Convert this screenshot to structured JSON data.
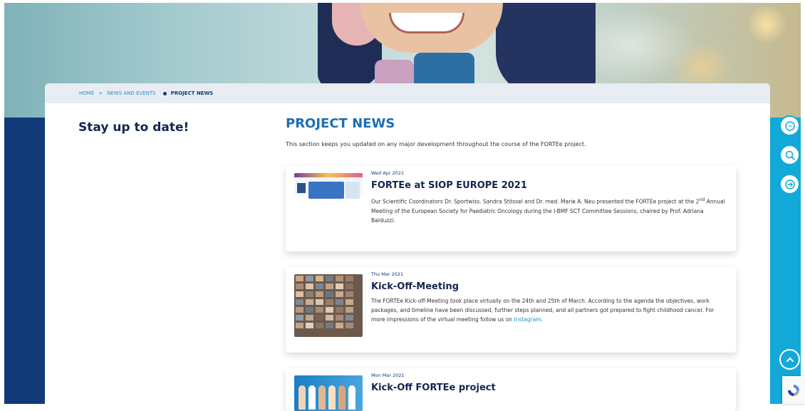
{
  "breadcrumb": {
    "home": "HOME",
    "separator": ">",
    "section": "NEWS AND EVENTS",
    "current": "PROJECT NEWS"
  },
  "sidebar": {
    "title": "Stay up to date!"
  },
  "main": {
    "title": "PROJECT NEWS",
    "intro": "This section keeps you updated on any major development throughout the course of the FORTEe project."
  },
  "news": [
    {
      "date": "Wed Apr 2021",
      "title": "FORTEe at SIOP EUROPE 2021",
      "text_a": "Our Scientific Coordinators Dr. Sportwiss. Sandra Stössel and Dr. med. Marie A. Neu presented the FORTEe project at the 2",
      "text_sup": "nd",
      "text_b": " Annual Meeting of the European Society for Paediatric Oncology during the I-BMF SCT Committee Sessions, chaired by Prof. Adriana Balduzzi."
    },
    {
      "date": "Thu Mar 2021",
      "title": "Kick-Off-Meeting",
      "text_a": "The FORTEe Kick-off-Meeting took place virtually on the 24th and 25th of March. According to the agenda the objectives, work packages, and timeline have been discussed, further steps planned, and all partners got prepared to fight childhood cancer. For more impressions of the virtual meeting follow us on ",
      "link": "Instagram",
      "text_b": "."
    },
    {
      "date": "Mon Mar 2021",
      "title": "Kick-Off FORTEe project"
    }
  ],
  "colors": {
    "navy": "#123a78",
    "cyan": "#12a9d9",
    "title_blue": "#1d6fb3",
    "breadcrumb_bg": "#e8ecf3"
  },
  "icons": [
    "chat-icon",
    "search-icon",
    "login-arrow-icon",
    "chevron-up-icon",
    "recaptcha-icon"
  ]
}
